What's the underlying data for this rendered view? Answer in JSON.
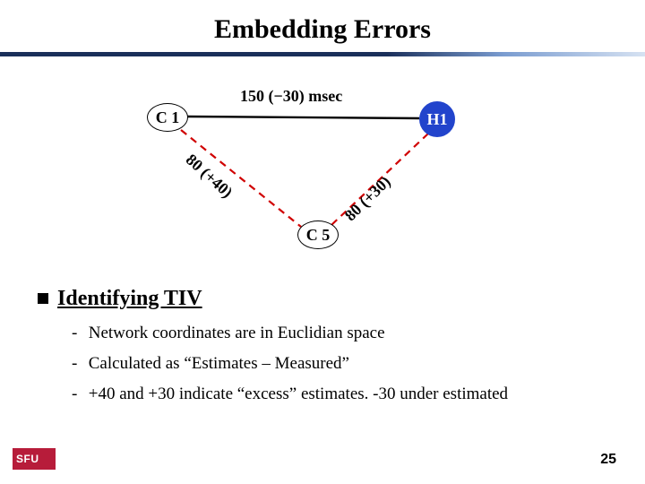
{
  "title": "Embedding Errors",
  "diagram": {
    "nodes": {
      "c1": "C 1",
      "h1": "H1",
      "c5": "C 5"
    },
    "edge_labels": {
      "c1_h1": "150 (−30) msec",
      "c1_c5": "80 (+40)",
      "h1_c5": "80 (+30)"
    }
  },
  "section_heading": "Identifying TIV",
  "bullets": [
    "Network coordinates are in Euclidian space",
    "Calculated as “Estimates – Measured”",
    "+40 and +30 indicate “excess” estimates. -30 under estimated"
  ],
  "footer_logo": "SFU",
  "page_number": "25"
}
